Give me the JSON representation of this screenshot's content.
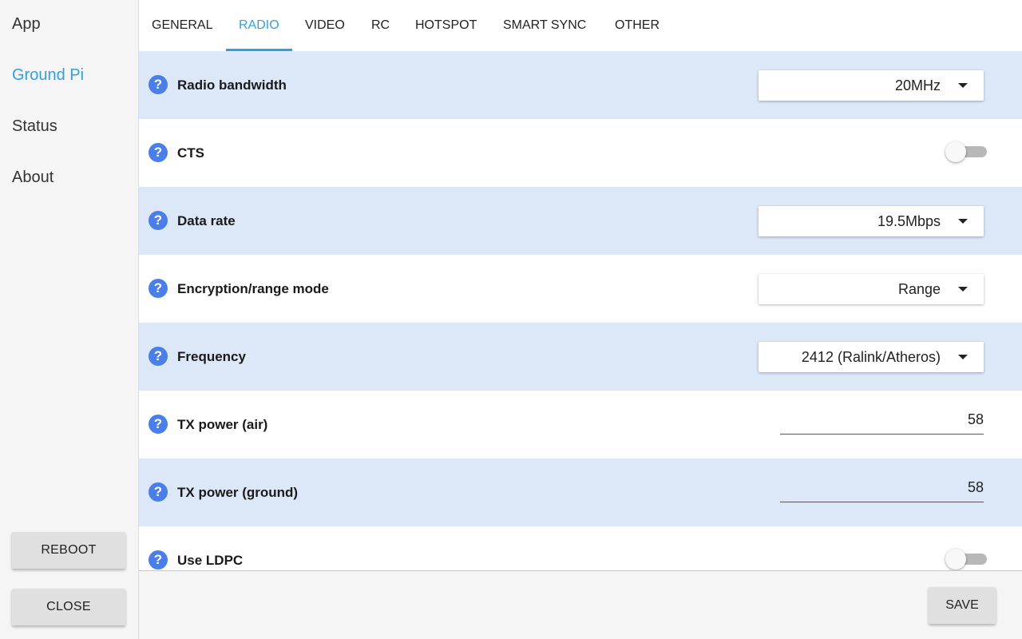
{
  "sidebar": {
    "items": [
      {
        "label": "App",
        "active": false
      },
      {
        "label": "Ground Pi",
        "active": true
      },
      {
        "label": "Status",
        "active": false
      },
      {
        "label": "About",
        "active": false
      }
    ],
    "reboot_label": "REBOOT",
    "close_label": "CLOSE"
  },
  "tabs": [
    {
      "label": "GENERAL",
      "active": false
    },
    {
      "label": "RADIO",
      "active": true
    },
    {
      "label": "VIDEO",
      "active": false
    },
    {
      "label": "RC",
      "active": false
    },
    {
      "label": "HOTSPOT",
      "active": false
    },
    {
      "label": "SMART SYNC",
      "active": false
    },
    {
      "label": "OTHER",
      "active": false
    }
  ],
  "settings": [
    {
      "label": "Radio bandwidth",
      "control": "dropdown",
      "value": "20MHz"
    },
    {
      "label": "CTS",
      "control": "toggle",
      "value": "off"
    },
    {
      "label": "Data rate",
      "control": "dropdown",
      "value": "19.5Mbps"
    },
    {
      "label": "Encryption/range mode",
      "control": "dropdown",
      "value": "Range"
    },
    {
      "label": "Frequency",
      "control": "dropdown",
      "value": "2412 (Ralink/Atheros)"
    },
    {
      "label": "TX power (air)",
      "control": "input",
      "value": "58"
    },
    {
      "label": "TX power (ground)",
      "control": "input",
      "value": "58"
    },
    {
      "label": "Use LDPC",
      "control": "toggle",
      "value": "off"
    }
  ],
  "help_glyph": "?",
  "footer": {
    "save_label": "SAVE"
  },
  "colors": {
    "accent": "#2fa1e0",
    "row_shaded": "#dce8f7",
    "help_icon": "#4a7ee8"
  }
}
